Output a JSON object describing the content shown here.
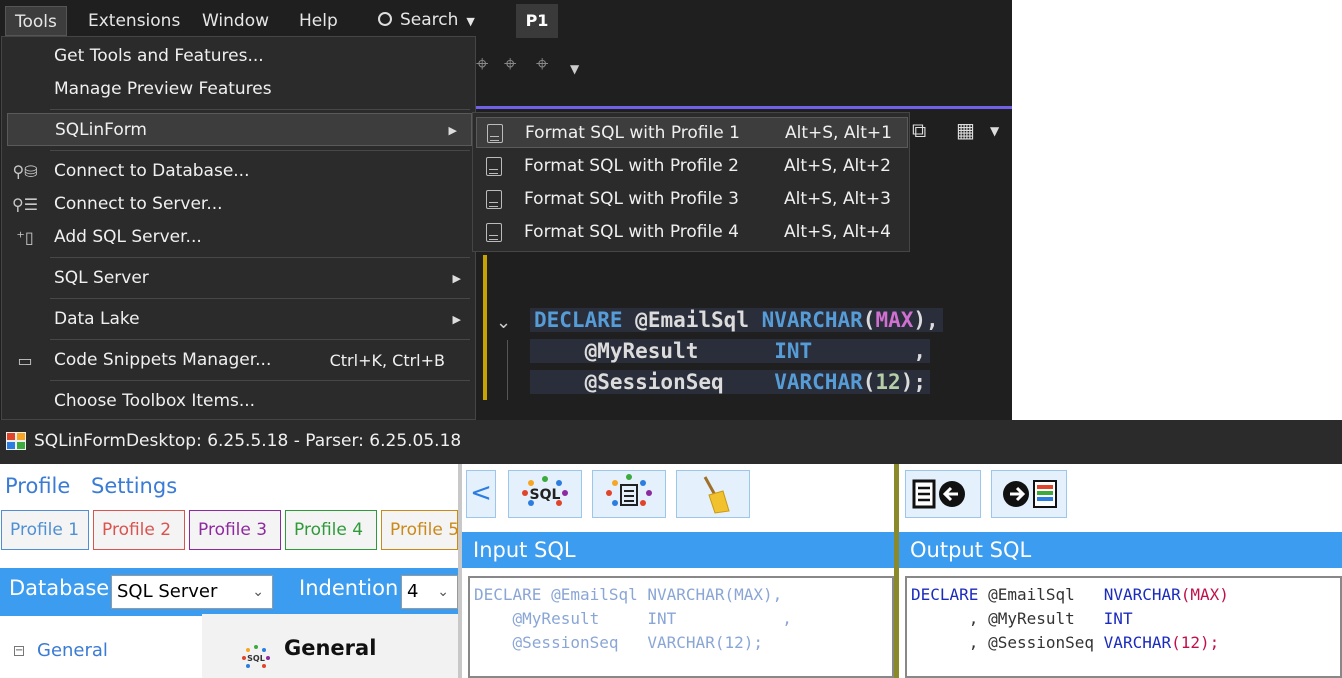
{
  "vs": {
    "menubar": {
      "items": [
        "Tools",
        "Extensions",
        "Window",
        "Help"
      ],
      "search_label": "Search",
      "profile_badge": "P1"
    },
    "tools_menu": {
      "items": [
        {
          "label": "Get Tools and Features..."
        },
        {
          "label": "Manage Preview Features"
        },
        {
          "label": "SQLinForm",
          "has_submenu": true
        },
        {
          "label": "Connect to Database...",
          "icon": "database-plug-icon"
        },
        {
          "label": "Connect to Server...",
          "icon": "server-plug-icon"
        },
        {
          "label": "Add SQL Server...",
          "icon": "add-server-icon"
        },
        {
          "label": "SQL Server",
          "has_submenu": true
        },
        {
          "label": "Data Lake",
          "has_submenu": true
        },
        {
          "label": "Code Snippets Manager...",
          "shortcut": "Ctrl+K, Ctrl+B",
          "icon": "snippet-icon"
        },
        {
          "label": "Choose Toolbox Items..."
        }
      ]
    },
    "sqlinform_submenu": {
      "items": [
        {
          "label": "Format SQL with Profile 1",
          "shortcut": "Alt+S, Alt+1"
        },
        {
          "label": "Format SQL with Profile 2",
          "shortcut": "Alt+S, Alt+2"
        },
        {
          "label": "Format SQL with Profile 3",
          "shortcut": "Alt+S, Alt+3"
        },
        {
          "label": "Format SQL with Profile 4",
          "shortcut": "Alt+S, Alt+4"
        }
      ]
    },
    "code": {
      "line1": {
        "kw": "DECLARE",
        "var": "@EmailSql",
        "type": "NVARCHAR",
        "p1": "(",
        "mx": "MAX",
        "p2": "),"
      },
      "line2": {
        "var": "@MyResult",
        "type": "INT",
        "trail": ","
      },
      "line3": {
        "var": "@SessionSeq",
        "type": "VARCHAR",
        "p1": "(",
        "num": "12",
        "p2": ");"
      }
    }
  },
  "app": {
    "title": "SQLinFormDesktop: 6.25.5.18 - Parser: 6.25.05.18",
    "nav_tabs": [
      "Profile",
      "Settings"
    ],
    "profiles": [
      {
        "label": "Profile 1",
        "color": "#4f8fd4"
      },
      {
        "label": "Profile 2",
        "color": "#d9534f"
      },
      {
        "label": "Profile 3",
        "color": "#8e2aa0"
      },
      {
        "label": "Profile 4",
        "color": "#2e9a3a"
      },
      {
        "label": "Profile 5",
        "color": "#c98a1a"
      }
    ],
    "database_label": "Database",
    "database_value": "SQL Server",
    "indention_label": "Indention",
    "indention_value": "4",
    "tree_general": "General",
    "general_heading": "General",
    "input_header": "Input SQL",
    "output_header": "Output SQL",
    "input_sql": {
      "l1a": "DECLARE @EmailSql NVARCHAR(MAX),",
      "l2a": "    @MyResult     INT           ,",
      "l3a": "    @SessionSeq   VARCHAR(12);"
    },
    "output_sql": {
      "l1": {
        "kw": "DECLARE",
        "var": "@EmailSql",
        "type": "NVARCHAR",
        "p1": "(",
        "mx": "MAX",
        "p2": ")"
      },
      "l2": {
        "lead": ", ",
        "var": "@MyResult",
        "type": "INT"
      },
      "l3": {
        "lead": ", ",
        "var": "@SessionSeq",
        "type": "VARCHAR",
        "p1": "(",
        "num": "12",
        "p2": ");"
      }
    }
  }
}
